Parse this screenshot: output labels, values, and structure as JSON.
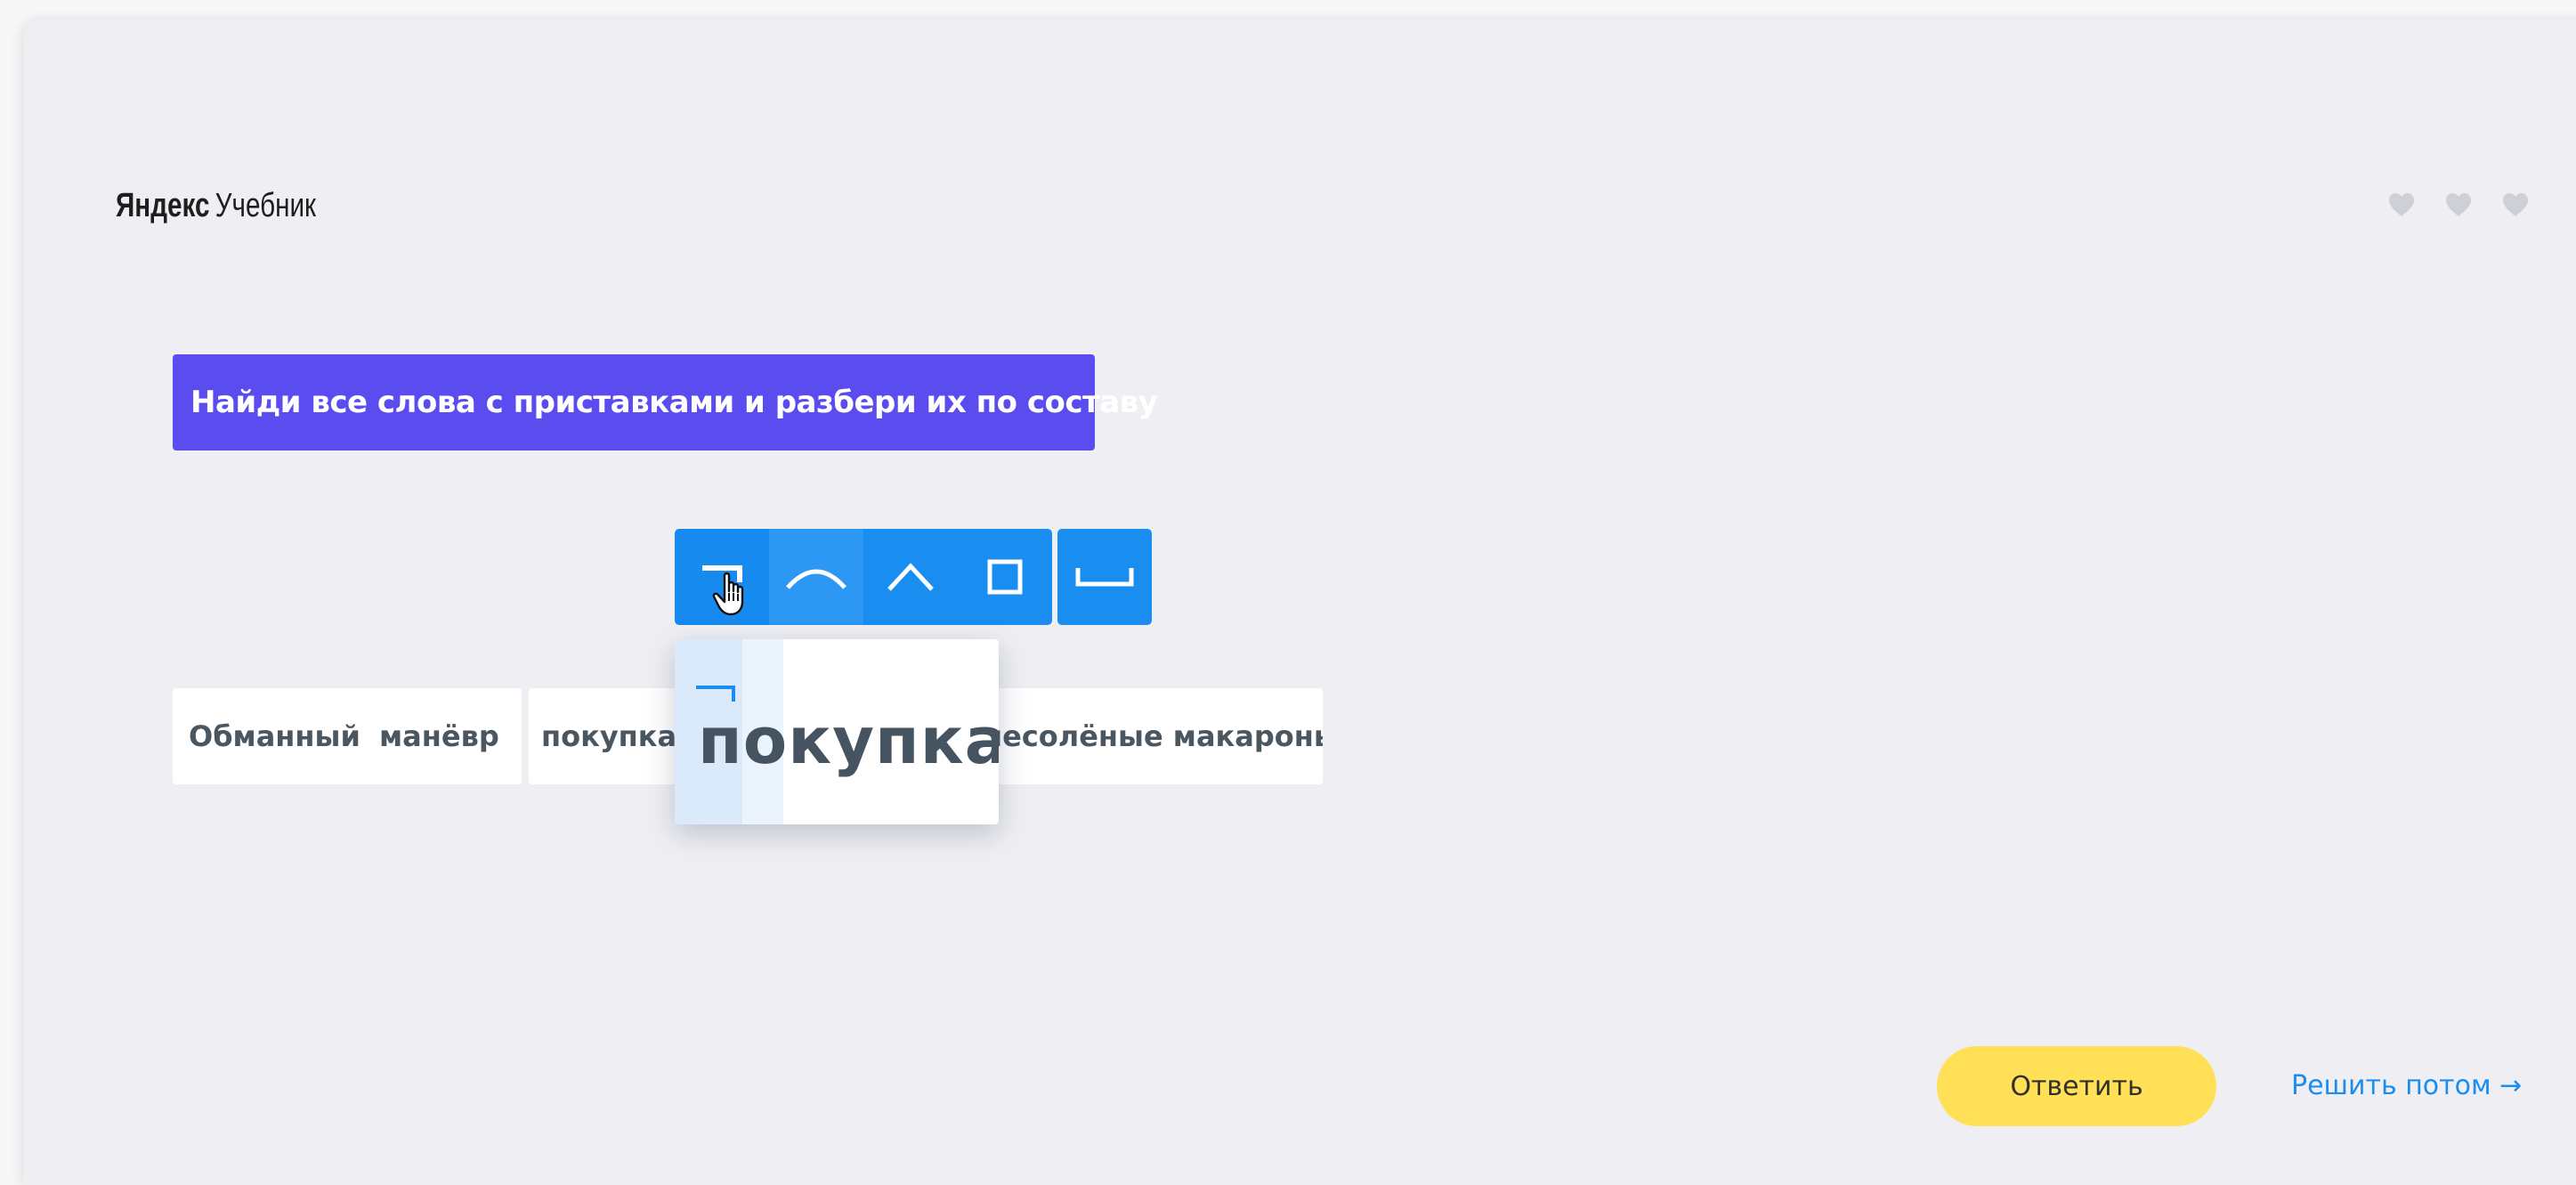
{
  "header": {
    "logo_brand": "Яндекс",
    "logo_product": "Учебник",
    "lives_icon": "heart-icon"
  },
  "task": {
    "instruction": "Найди все слова с приставками и разбери их по составу"
  },
  "toolbar": {
    "tools": [
      {
        "name": "prefix",
        "icon": "prefix-icon"
      },
      {
        "name": "root",
        "icon": "root-arc-icon"
      },
      {
        "name": "suffix",
        "icon": "suffix-caret-icon"
      },
      {
        "name": "ending",
        "icon": "ending-square-icon"
      },
      {
        "name": "base",
        "icon": "base-bracket-icon"
      }
    ]
  },
  "words": {
    "w1": "Обманный  манёвр",
    "w2": "покупка",
    "w3": "несолёные макароны"
  },
  "popup": {
    "word": "покупка"
  },
  "footer": {
    "answer_label": "Ответить",
    "later_label": "Решить потом →"
  },
  "colors": {
    "task_bg": "#5b4cf0",
    "tool_bg": "#1a8df0",
    "answer_bg": "#ffe057",
    "link": "#1a8df0",
    "card_bg": "#efeff3"
  }
}
